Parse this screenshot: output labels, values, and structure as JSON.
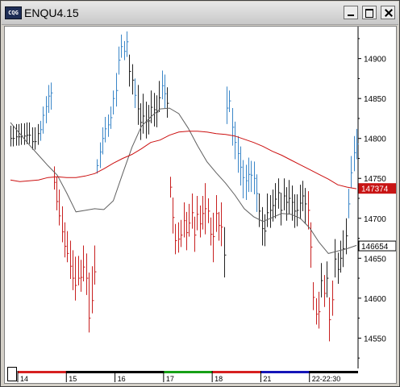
{
  "window": {
    "title": "ENQU4.15",
    "app_icon_text": "CQG",
    "minimize_label": "minimize",
    "maximize_label": "maximize",
    "close_label": "close"
  },
  "chart_data": {
    "type": "bar",
    "style": "OHLC price bars with two moving averages",
    "y_ticks": [
      14550,
      14600,
      14650,
      14700,
      14750,
      14800,
      14850,
      14900
    ],
    "y_tick_labels": [
      "14550",
      "14600",
      "14650",
      "14700",
      "14750",
      "14800",
      "14850",
      "14900"
    ],
    "ylim": [
      14512,
      14938
    ],
    "x_labels": [
      "14",
      "15",
      "16",
      "17",
      "18",
      "21",
      "22-22:30"
    ],
    "session_colors": [
      "#d62020",
      "#000000",
      "#000000",
      "#17a017",
      "#d62020",
      "#1515b8",
      "#000000"
    ],
    "price_label_ma_long": "14737.4",
    "price_label_last": "14665.4",
    "colors": {
      "up": "#3a86c8",
      "down": "#c82020",
      "neutral": "#222222",
      "ma_long": "#cc1010",
      "ma_short": "#606060"
    },
    "grid": false,
    "bars": [
      [
        14816,
        14790,
        14800,
        "k"
      ],
      [
        14816,
        14790,
        14800,
        "k"
      ],
      [
        14818,
        14791,
        14802,
        "k"
      ],
      [
        14818,
        14791,
        14802,
        "k"
      ],
      [
        14819,
        14792,
        14803,
        "k"
      ],
      [
        14819,
        14792,
        14803,
        "k"
      ],
      [
        14820,
        14793,
        14804,
        "k"
      ],
      [
        14820,
        14793,
        14804,
        "k"
      ],
      [
        14814,
        14786,
        14796,
        "k"
      ],
      [
        14814,
        14786,
        14796,
        "k"
      ],
      [
        14818,
        14792,
        14806,
        "k"
      ],
      [
        14822,
        14797,
        14811,
        "b"
      ],
      [
        14840,
        14806,
        14829,
        "b"
      ],
      [
        14853,
        14819,
        14840,
        "b"
      ],
      [
        14867,
        14832,
        14853,
        "b"
      ],
      [
        14870,
        14836,
        14857,
        "b"
      ],
      [
        14765,
        14736,
        14745,
        "r"
      ],
      [
        14752,
        14710,
        14721,
        "r"
      ],
      [
        14736,
        14691,
        14703,
        "r"
      ],
      [
        14715,
        14670,
        14683,
        "r"
      ],
      [
        14695,
        14651,
        14665,
        "r"
      ],
      [
        14684,
        14645,
        14656,
        "r"
      ],
      [
        14672,
        14624,
        14640,
        "r"
      ],
      [
        14660,
        14610,
        14625,
        "r"
      ],
      [
        14652,
        14597,
        14616,
        "r"
      ],
      [
        14653,
        14616,
        14625,
        "r"
      ],
      [
        14648,
        14608,
        14626,
        "r"
      ],
      [
        14666,
        14621,
        14639,
        "r"
      ],
      [
        14656,
        14604,
        14625,
        "r"
      ],
      [
        14632,
        14557,
        14575,
        "r"
      ],
      [
        14640,
        14581,
        14597,
        "r"
      ],
      [
        14666,
        14617,
        14633,
        "r"
      ],
      [
        14774,
        14756,
        14766,
        "b"
      ],
      [
        14795,
        14763,
        14783,
        "b"
      ],
      [
        14814,
        14780,
        14800,
        "b"
      ],
      [
        14827,
        14795,
        14812,
        "b"
      ],
      [
        14830,
        14802,
        14817,
        "b"
      ],
      [
        14840,
        14812,
        14826,
        "b"
      ],
      [
        14860,
        14830,
        14850,
        "b"
      ],
      [
        14882,
        14840,
        14860,
        "b"
      ],
      [
        14915,
        14880,
        14898,
        "b"
      ],
      [
        14930,
        14901,
        14915,
        "b"
      ],
      [
        14922,
        14898,
        14909,
        "b"
      ],
      [
        14934,
        14902,
        14921,
        "b"
      ],
      [
        14905,
        14865,
        14884,
        "k"
      ],
      [
        14893,
        14855,
        14873,
        "k"
      ],
      [
        14875,
        14838,
        14854,
        "b"
      ],
      [
        14867,
        14817,
        14837,
        "k"
      ],
      [
        14844,
        14798,
        14820,
        "k"
      ],
      [
        14856,
        14806,
        14828,
        "k"
      ],
      [
        14846,
        14800,
        14821,
        "k"
      ],
      [
        14842,
        14805,
        14822,
        "k"
      ],
      [
        14860,
        14819,
        14839,
        "k"
      ],
      [
        14857,
        14815,
        14836,
        "k"
      ],
      [
        14854,
        14814,
        14833,
        "k"
      ],
      [
        14872,
        14833,
        14851,
        "k"
      ],
      [
        14885,
        14849,
        14866,
        "b"
      ],
      [
        14880,
        14838,
        14856,
        "b"
      ],
      [
        14864,
        14826,
        14844,
        "k"
      ],
      [
        14752,
        14726,
        14739,
        "r"
      ],
      [
        14726,
        14681,
        14701,
        "r"
      ],
      [
        14693,
        14655,
        14672,
        "r"
      ],
      [
        14695,
        14657,
        14674,
        "r"
      ],
      [
        14698,
        14664,
        14679,
        "r"
      ],
      [
        14720,
        14676,
        14697,
        "r"
      ],
      [
        14708,
        14660,
        14682,
        "r"
      ],
      [
        14718,
        14677,
        14694,
        "r"
      ],
      [
        14731,
        14687,
        14707,
        "r"
      ],
      [
        14702,
        14658,
        14679,
        "r"
      ],
      [
        14728,
        14685,
        14705,
        "r"
      ],
      [
        14716,
        14676,
        14693,
        "r"
      ],
      [
        14728,
        14686,
        14706,
        "r"
      ],
      [
        14744,
        14680,
        14712,
        "r"
      ],
      [
        14725,
        14694,
        14709,
        "r"
      ],
      [
        14701,
        14666,
        14680,
        "r"
      ],
      [
        14707,
        14645,
        14677,
        "r"
      ],
      [
        14729,
        14683,
        14706,
        "r"
      ],
      [
        14708,
        14672,
        14691,
        "r"
      ],
      [
        14720,
        14665,
        14689,
        "r"
      ],
      [
        14689,
        14626,
        14654,
        "k"
      ],
      [
        14865,
        14818,
        14838,
        "b"
      ],
      [
        14860,
        14833,
        14847,
        "b"
      ],
      [
        14838,
        14791,
        14814,
        "b"
      ],
      [
        14821,
        14774,
        14795,
        "b"
      ],
      [
        14803,
        14757,
        14781,
        "b"
      ],
      [
        14790,
        14741,
        14764,
        "b"
      ],
      [
        14773,
        14725,
        14751,
        "b"
      ],
      [
        14767,
        14723,
        14747,
        "b"
      ],
      [
        14776,
        14733,
        14755,
        "b"
      ],
      [
        14772,
        14733,
        14754,
        "b"
      ],
      [
        14771,
        14730,
        14750,
        "b"
      ],
      [
        14755,
        14708,
        14731,
        "b"
      ],
      [
        14731,
        14689,
        14709,
        "k"
      ],
      [
        14714,
        14666,
        14687,
        "k"
      ],
      [
        14705,
        14665,
        14684,
        "k"
      ],
      [
        14731,
        14689,
        14707,
        "k"
      ],
      [
        14729,
        14688,
        14710,
        "k"
      ],
      [
        14736,
        14696,
        14716,
        "k"
      ],
      [
        14744,
        14700,
        14724,
        "k"
      ],
      [
        14750,
        14712,
        14732,
        "k"
      ],
      [
        14732,
        14691,
        14710,
        "k"
      ],
      [
        14750,
        14710,
        14728,
        "k"
      ],
      [
        14739,
        14697,
        14720,
        "k"
      ],
      [
        14748,
        14705,
        14725,
        "k"
      ],
      [
        14741,
        14697,
        14720,
        "k"
      ],
      [
        14730,
        14688,
        14709,
        "k"
      ],
      [
        14730,
        14690,
        14710,
        "k"
      ],
      [
        14742,
        14699,
        14719,
        "k"
      ],
      [
        14747,
        14709,
        14728,
        "k"
      ],
      [
        14738,
        14693,
        14718,
        "k"
      ],
      [
        14734,
        14686,
        14710,
        "r"
      ],
      [
        14695,
        14638,
        14664,
        "r"
      ],
      [
        14620,
        14585,
        14601,
        "r"
      ],
      [
        14600,
        14567,
        14580,
        "r"
      ],
      [
        14608,
        14562,
        14583,
        "r"
      ],
      [
        14644,
        14601,
        14622,
        "k"
      ],
      [
        14629,
        14589,
        14606,
        "r"
      ],
      [
        14646,
        14601,
        14625,
        "k"
      ],
      [
        14601,
        14546,
        14573,
        "r"
      ],
      [
        14622,
        14578,
        14598,
        "r"
      ],
      [
        14674,
        14626,
        14649,
        "k"
      ],
      [
        14657,
        14618,
        14636,
        "k"
      ],
      [
        14672,
        14632,
        14650,
        "k"
      ],
      [
        14685,
        14639,
        14662,
        "k"
      ],
      [
        14700,
        14655,
        14678,
        "k"
      ],
      [
        14737,
        14700,
        14718,
        "b"
      ],
      [
        14778,
        14738,
        14757,
        "b"
      ],
      [
        14803,
        14759,
        14782,
        "b"
      ],
      [
        14812,
        14774,
        14793,
        "b"
      ]
    ],
    "ma_long": [
      14748,
      14746,
      14747,
      14748,
      14751,
      14752,
      14751,
      14751,
      14753,
      14756,
      14762,
      14769,
      14775,
      14780,
      14787,
      14795,
      14798,
      14804,
      14808,
      14809,
      14809,
      14808,
      14806,
      14805,
      14803,
      14799,
      14795,
      14790,
      14784,
      14779,
      14773,
      14767,
      14761,
      14755,
      14749,
      14742,
      14739,
      14737
    ],
    "ma_short": [
      14820,
      14806,
      14792,
      14779,
      14766,
      14754,
      14732,
      14708,
      14710,
      14712,
      14711,
      14722,
      14756,
      14789,
      14815,
      14827,
      14837,
      14838,
      14831,
      14813,
      14791,
      14771,
      14757,
      14744,
      14729,
      14712,
      14702,
      14696,
      14701,
      14706,
      14705,
      14700,
      14688,
      14670,
      14656,
      14659,
      14662,
      14666
    ]
  }
}
